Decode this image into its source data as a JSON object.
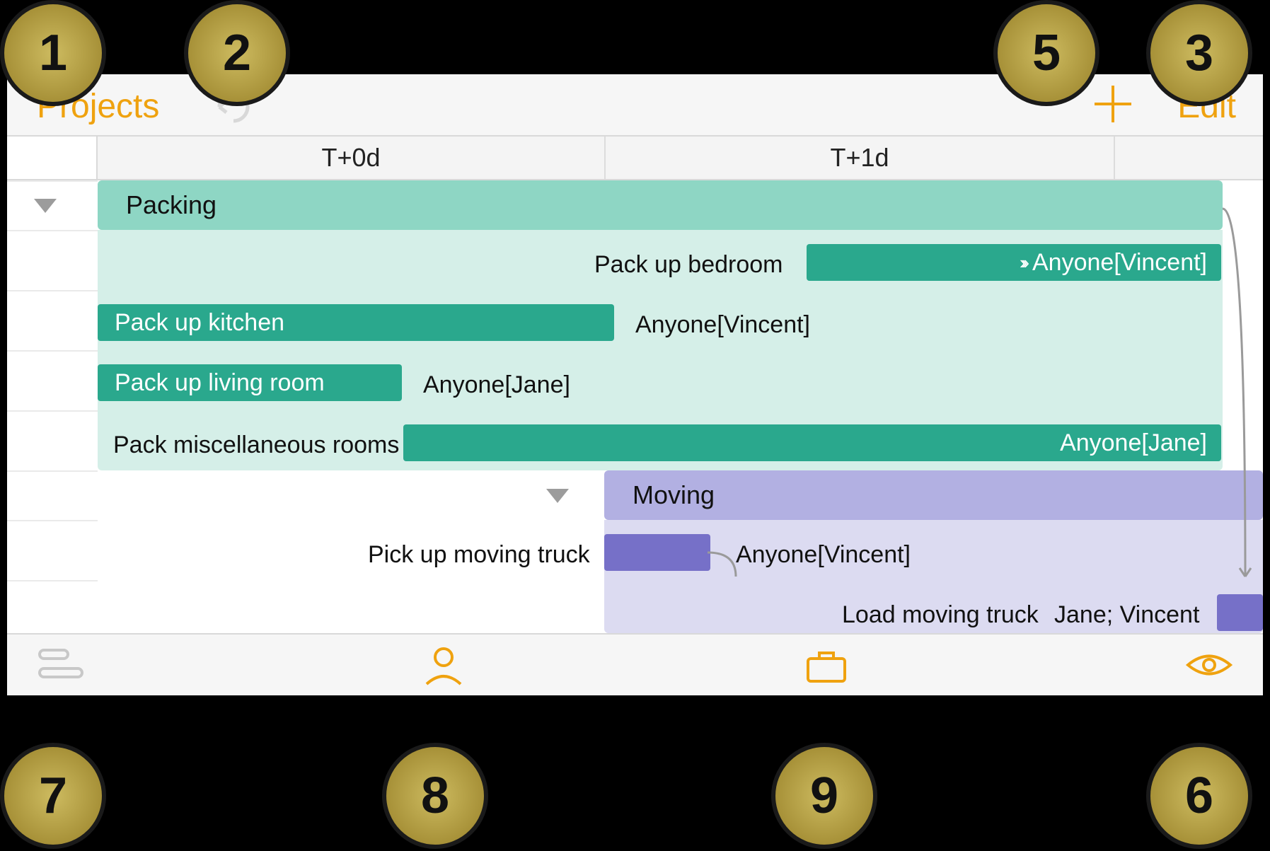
{
  "toolbar": {
    "title": "Projects",
    "edit_label": "Edit"
  },
  "timeline": {
    "columns": [
      "T+0d",
      "T+1d"
    ]
  },
  "groups": [
    {
      "name": "Packing",
      "color": "teal",
      "tasks": [
        {
          "name": "Pack up bedroom",
          "assignee": "Anyone[Vincent]"
        },
        {
          "name": "Pack up kitchen",
          "assignee": "Anyone[Vincent]"
        },
        {
          "name": "Pack up living room",
          "assignee": "Anyone[Jane]"
        },
        {
          "name": "Pack miscellaneous rooms",
          "assignee": "Anyone[Jane]"
        }
      ]
    },
    {
      "name": "Moving",
      "color": "purple",
      "tasks": [
        {
          "name": "Pick up moving truck",
          "assignee": "Anyone[Vincent]"
        },
        {
          "name": "Load moving truck",
          "assignee": "Jane; Vincent"
        }
      ]
    }
  ],
  "callouts": [
    "1",
    "2",
    "3",
    "5",
    "6",
    "7",
    "8",
    "9"
  ]
}
